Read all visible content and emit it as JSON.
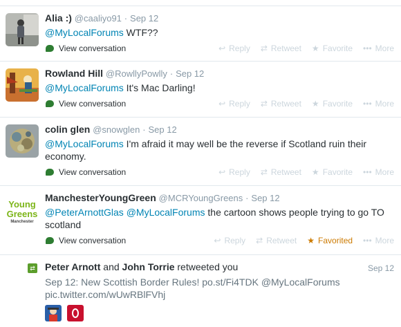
{
  "tweets": [
    {
      "name": "Alia :)",
      "handle": "@caaliyo91",
      "time": "Sep 12",
      "mention": "@MyLocalForums",
      "text": " WTF??",
      "view": "View conversation",
      "reply": "Reply",
      "retweet": "Retweet",
      "favorite": "Favorite",
      "more": "More"
    },
    {
      "name": "Rowland Hill",
      "handle": "@RowllyPowlly",
      "time": "Sep 12",
      "mention": "@MyLocalForums",
      "text": " It's Mac Darling!",
      "view": "View conversation",
      "reply": "Reply",
      "retweet": "Retweet",
      "favorite": "Favorite",
      "more": "More"
    },
    {
      "name": "colin glen",
      "handle": "@snowglen",
      "time": "Sep 12",
      "mention": "@MyLocalForums",
      "text": "  I'm afraid it may well be the reverse if Scotland ruin their economy.",
      "view": "View conversation",
      "reply": "Reply",
      "retweet": "Retweet",
      "favorite": "Favorite",
      "more": "More"
    },
    {
      "name": "ManchesterYoungGreen",
      "handle": "@MCRYoungGreens",
      "time": "Sep 12",
      "mention": "@PeterArnottGlas",
      "mention2": "@MyLocalForums",
      "text": " the cartoon shows people trying to go TO scotland",
      "view": "View conversation",
      "reply": "Reply",
      "retweet": "Retweet",
      "favorite": "Favorited",
      "more": "More",
      "logo_line1": "Young",
      "logo_line2": "Greens",
      "logo_line3": "Manchester"
    }
  ],
  "retweet_notice": {
    "user1": "Peter Arnott",
    "and": " and ",
    "user2": "John Torrie",
    "suffix": " retweeted you",
    "time": "Sep 12",
    "body_prefix": "Sep 12: New Scottish Border Rules! po.st/Fi4TDK ",
    "body_mention": "@MyLocalForums",
    "body_link": "pic.twitter.com/wUwRBlFVhj"
  },
  "colors": {
    "link": "#0084b4",
    "favorited": "#cc7a00",
    "conversation": "#2e7d32",
    "retweet_badge": "#5c9e2c"
  }
}
